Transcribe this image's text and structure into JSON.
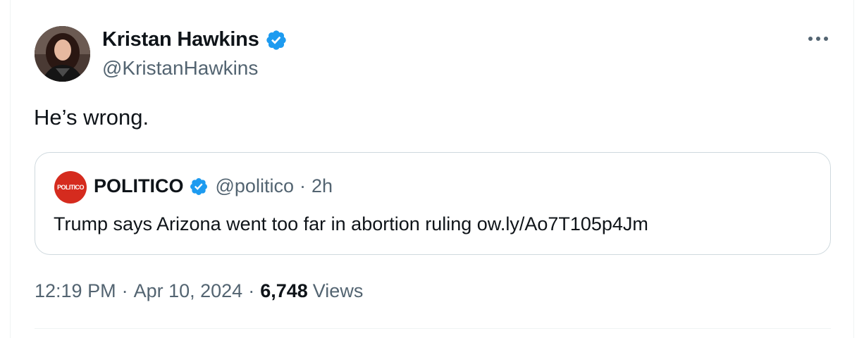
{
  "author": {
    "name": "Kristan Hawkins",
    "handle": "@KristanHawkins",
    "verified": true
  },
  "tweet": {
    "text": "He’s wrong."
  },
  "quote": {
    "avatar_text": "POLITICO",
    "name": "POLITICO",
    "handle": "@politico",
    "separator": "·",
    "time": "2h",
    "text": "Trump says Arizona went too far in abortion ruling ow.ly/Ao7T105p4Jm",
    "avatar_color": "#d52b1e"
  },
  "meta": {
    "time": "12:19 PM",
    "separator": "·",
    "date": "Apr 10, 2024",
    "views_count": "6,748",
    "views_label": "Views"
  },
  "colors": {
    "verified": "#1d9bf0",
    "secondary_text": "#536471",
    "primary_text": "#0f1419",
    "border": "#cfd9de"
  },
  "icons": {
    "verified": "verified-badge-icon",
    "more": "more-horizontal-icon"
  }
}
